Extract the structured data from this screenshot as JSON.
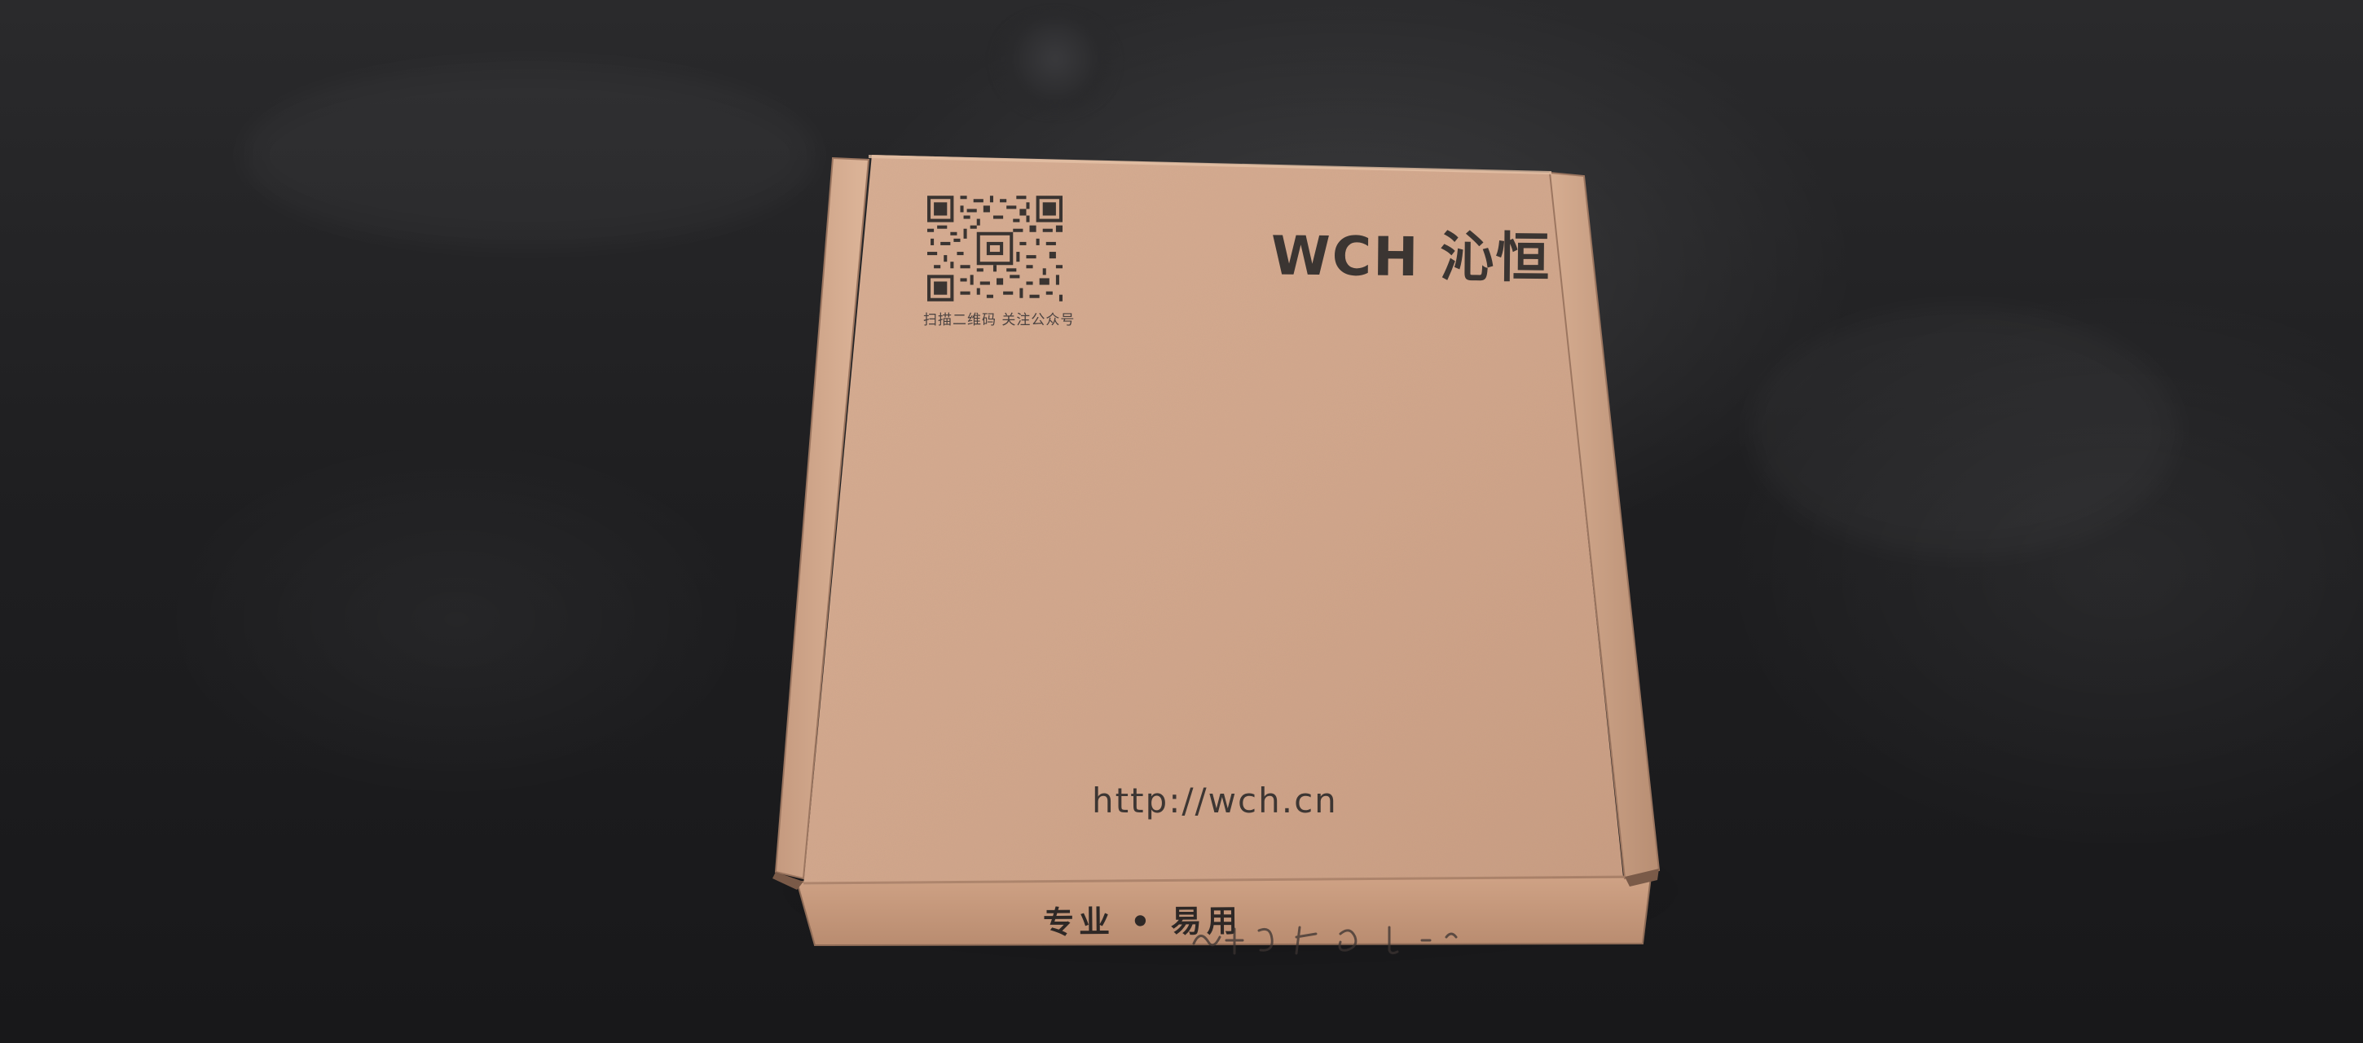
{
  "box": {
    "logo_text": "WCH 沁恒",
    "qr_caption": "扫描二维码 关注公众号",
    "url": "http://wch.cn",
    "slogan": "专业 • 易用"
  },
  "colors": {
    "background": "#1f1f21",
    "cardboard": "#d3a98f",
    "ink": "#3a3431"
  }
}
